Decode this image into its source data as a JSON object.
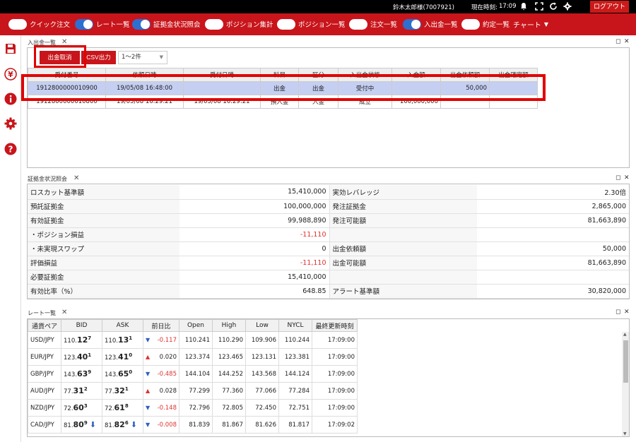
{
  "header": {
    "user": "鈴木太郎様(7007921)",
    "time_label": "現在時刻:",
    "time": "17:09",
    "logout": "ログアウト"
  },
  "toolbar": {
    "toggles": [
      {
        "label": "クイック注文",
        "on": false
      },
      {
        "label": "レート一覧",
        "on": true
      },
      {
        "label": "証拠金状況照会",
        "on": true
      },
      {
        "label": "ポジション集計",
        "on": false
      },
      {
        "label": "ポジション一覧",
        "on": false
      },
      {
        "label": "注文一覧",
        "on": false
      },
      {
        "label": "入出金一覧",
        "on": true
      },
      {
        "label": "約定一覧",
        "on": false
      }
    ],
    "chart": "チャート"
  },
  "panel_deposit": {
    "title": "入出金一覧",
    "cancel_btn": "出金取消",
    "csv_btn": "CSV出力",
    "count_select": "1～2件",
    "columns": [
      "受付番号",
      "依頼日時",
      "受付日時",
      "科目",
      "区分",
      "入出金状態",
      "入金額",
      "出金依頼額",
      "出金確定額"
    ],
    "rows": [
      [
        "1912800000010900",
        "19/05/08 16:48:00",
        "",
        "出金",
        "出金",
        "受付中",
        "",
        "50,000",
        ""
      ],
      [
        "1912800000010800",
        "19/05/08 16:29:21",
        "19/05/08 16:29:21",
        "預入金",
        "入金",
        "成立",
        "100,000,000",
        "",
        ""
      ]
    ]
  },
  "panel_margin": {
    "title": "証拠金状況照会",
    "rows": [
      {
        "l1": "ロスカット基準額",
        "v1": "15,410,000",
        "l2": "実効レバレッジ",
        "v2": "2.30倍"
      },
      {
        "l1": "預託証拠金",
        "v1": "100,000,000",
        "l2": "発注証拠金",
        "v2": "2,865,000"
      },
      {
        "l1": "有効証拠金",
        "v1": "99,988,890",
        "l2": "発注可能額",
        "v2": "81,663,890"
      },
      {
        "l1": "・ポジション損益",
        "v1": "-11,110",
        "l2": "",
        "v2": ""
      },
      {
        "l1": "・未実現スワップ",
        "v1": "0",
        "l2": "出金依頼額",
        "v2": "50,000"
      },
      {
        "l1": "評価損益",
        "v1": "-11,110",
        "l2": "出金可能額",
        "v2": "81,663,890"
      },
      {
        "l1": "必要証拠金",
        "v1": "15,410,000",
        "l2": "",
        "v2": ""
      },
      {
        "l1": "有効比率（%）",
        "v1": "648.85",
        "l2": "アラート基準額",
        "v2": "30,820,000"
      }
    ]
  },
  "panel_rates": {
    "title": "レート一覧",
    "columns": [
      "通貨ペア",
      "BID",
      "ASK",
      "前日比",
      "Open",
      "High",
      "Low",
      "NYCL",
      "最終更新時刻"
    ],
    "rows": [
      {
        "pair": "USD/JPY",
        "bid_a": "110.",
        "bid_b": "12",
        "bid_c": "7",
        "ask_a": "110.",
        "ask_b": "13",
        "ask_c": "1",
        "dir": "down",
        "chg": "-0.117",
        "open": "110.241",
        "high": "110.290",
        "low": "109.906",
        "nycl": "110.244",
        "time": "17:09:00"
      },
      {
        "pair": "EUR/JPY",
        "bid_a": "123.",
        "bid_b": "40",
        "bid_c": "1",
        "ask_a": "123.",
        "ask_b": "41",
        "ask_c": "0",
        "dir": "up",
        "chg": "0.020",
        "open": "123.374",
        "high": "123.465",
        "low": "123.131",
        "nycl": "123.381",
        "time": "17:09:00"
      },
      {
        "pair": "GBP/JPY",
        "bid_a": "143.",
        "bid_b": "63",
        "bid_c": "9",
        "ask_a": "143.",
        "ask_b": "65",
        "ask_c": "0",
        "dir": "down",
        "chg": "-0.485",
        "open": "144.104",
        "high": "144.252",
        "low": "143.568",
        "nycl": "144.124",
        "time": "17:09:00"
      },
      {
        "pair": "AUD/JPY",
        "bid_a": "77.",
        "bid_b": "31",
        "bid_c": "2",
        "ask_a": "77.",
        "ask_b": "32",
        "ask_c": "1",
        "dir": "up",
        "chg": "0.028",
        "open": "77.299",
        "high": "77.360",
        "low": "77.066",
        "nycl": "77.284",
        "time": "17:09:00"
      },
      {
        "pair": "NZD/JPY",
        "bid_a": "72.",
        "bid_b": "60",
        "bid_c": "3",
        "ask_a": "72.",
        "ask_b": "61",
        "ask_c": "8",
        "dir": "down",
        "chg": "-0.148",
        "open": "72.796",
        "high": "72.805",
        "low": "72.450",
        "nycl": "72.751",
        "time": "17:09:00"
      },
      {
        "pair": "CAD/JPY",
        "bid_a": "81.",
        "bid_b": "80",
        "bid_c": "9",
        "ask_a": "81.",
        "ask_b": "82",
        "ask_c": "6",
        "dir": "down",
        "chg": "-0.008",
        "open": "81.839",
        "high": "81.867",
        "low": "81.626",
        "nycl": "81.817",
        "time": "17:09:02"
      }
    ]
  },
  "colors": {
    "accent": "#c8151b",
    "highlight": "#e20000",
    "selected_row": "#c5cff2",
    "switch_on": "#2c6fd1"
  }
}
